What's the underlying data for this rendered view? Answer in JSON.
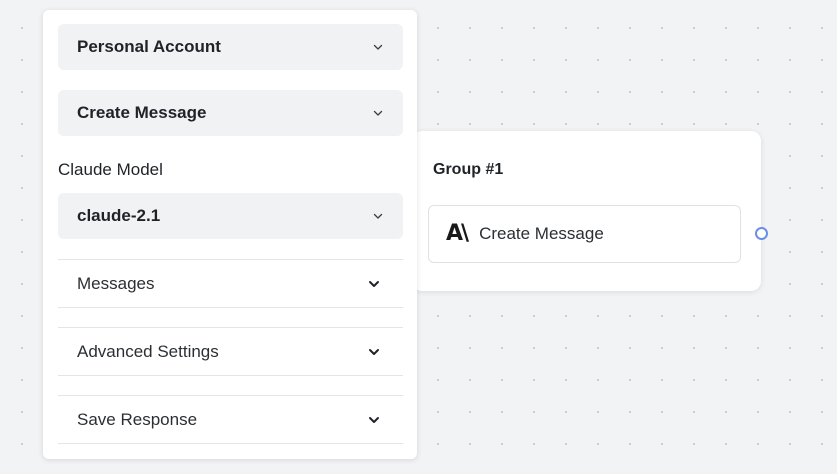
{
  "panel": {
    "account": {
      "label": "Personal Account"
    },
    "action": {
      "label": "Create Message"
    },
    "model": {
      "section_label": "Claude Model",
      "value": "claude-2.1"
    },
    "sections": [
      {
        "label": "Messages"
      },
      {
        "label": "Advanced Settings"
      },
      {
        "label": "Save Response"
      }
    ]
  },
  "group": {
    "title": "Group #1",
    "step": {
      "logo_text": "A\\",
      "logo_icon": "anthropic-logo-icon",
      "label": "Create Message"
    }
  },
  "colors": {
    "canvas": "#f2f3f5",
    "field_bg": "#f1f2f4",
    "handle": "#6b8fe6"
  }
}
